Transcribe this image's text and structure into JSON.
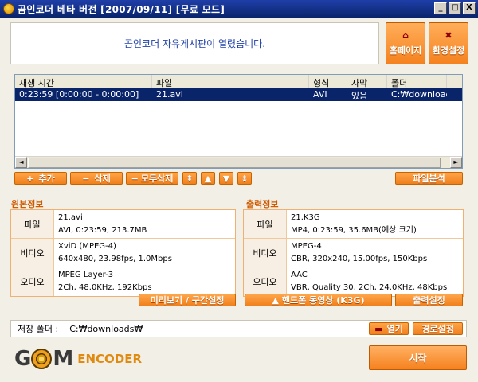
{
  "window": {
    "title": "곰인코더 베타 버전 [2007/09/11] [무료 모드]",
    "controls": [
      "_",
      "□",
      "X"
    ]
  },
  "notice": {
    "text": "곰인코더 자유게시판이 열렸습니다."
  },
  "top_buttons": {
    "home": "홈페이지",
    "settings": "환경설정"
  },
  "file_list": {
    "columns": [
      "재생 시간",
      "파일",
      "형식",
      "자막",
      "폴더"
    ],
    "rows": [
      {
        "duration": "0:23:59 [0:00:00 - 0:00:00]",
        "file": "21.avi",
        "format": "AVI",
        "subtitle": "있음",
        "folder": "C:₩downloads₩"
      }
    ]
  },
  "list_buttons": {
    "add": "추가",
    "delete": "삭제",
    "delete_all": "모두삭제",
    "analyze": "파일분석"
  },
  "source_info": {
    "heading": "원본정보",
    "rows": [
      {
        "label": "파일",
        "line1": "21.avi",
        "line2": "AVI, 0:23:59, 213.7MB"
      },
      {
        "label": "비디오",
        "line1": "XviD (MPEG-4)",
        "line2": "640x480, 23.98fps, 1.0Mbps"
      },
      {
        "label": "오디오",
        "line1": "MPEG Layer-3",
        "line2": "2Ch, 48.0KHz, 192Kbps"
      }
    ],
    "button": "미리보기 / 구간설정"
  },
  "output_info": {
    "heading": "출력정보",
    "rows": [
      {
        "label": "파일",
        "line1": "21.K3G",
        "line2": "MP4, 0:23:59, 35.6MB(예상 크기)"
      },
      {
        "label": "비디오",
        "line1": "MPEG-4",
        "line2": "CBR, 320x240, 15.00fps, 150Kbps"
      },
      {
        "label": "오디오",
        "line1": "AAC",
        "line2": "VBR, Quality 30, 2Ch, 24.0KHz, 48Kbps"
      }
    ],
    "preset_button": "핸드폰 동영상 (K3G)",
    "settings_button": "출력설정"
  },
  "save_folder": {
    "label": "저장 폴더 :",
    "path": "C:₩downloads₩",
    "open_button": "열기",
    "change_button": "경로설정"
  },
  "logo": {
    "part1": "G",
    "part2": "M",
    "encoder": "ENCODER"
  },
  "start_button": "시작",
  "colors": {
    "accent": "#f5821f",
    "selection": "#0a246a",
    "notice_text": "#1f3fa8",
    "section_heading": "#d05a00"
  }
}
